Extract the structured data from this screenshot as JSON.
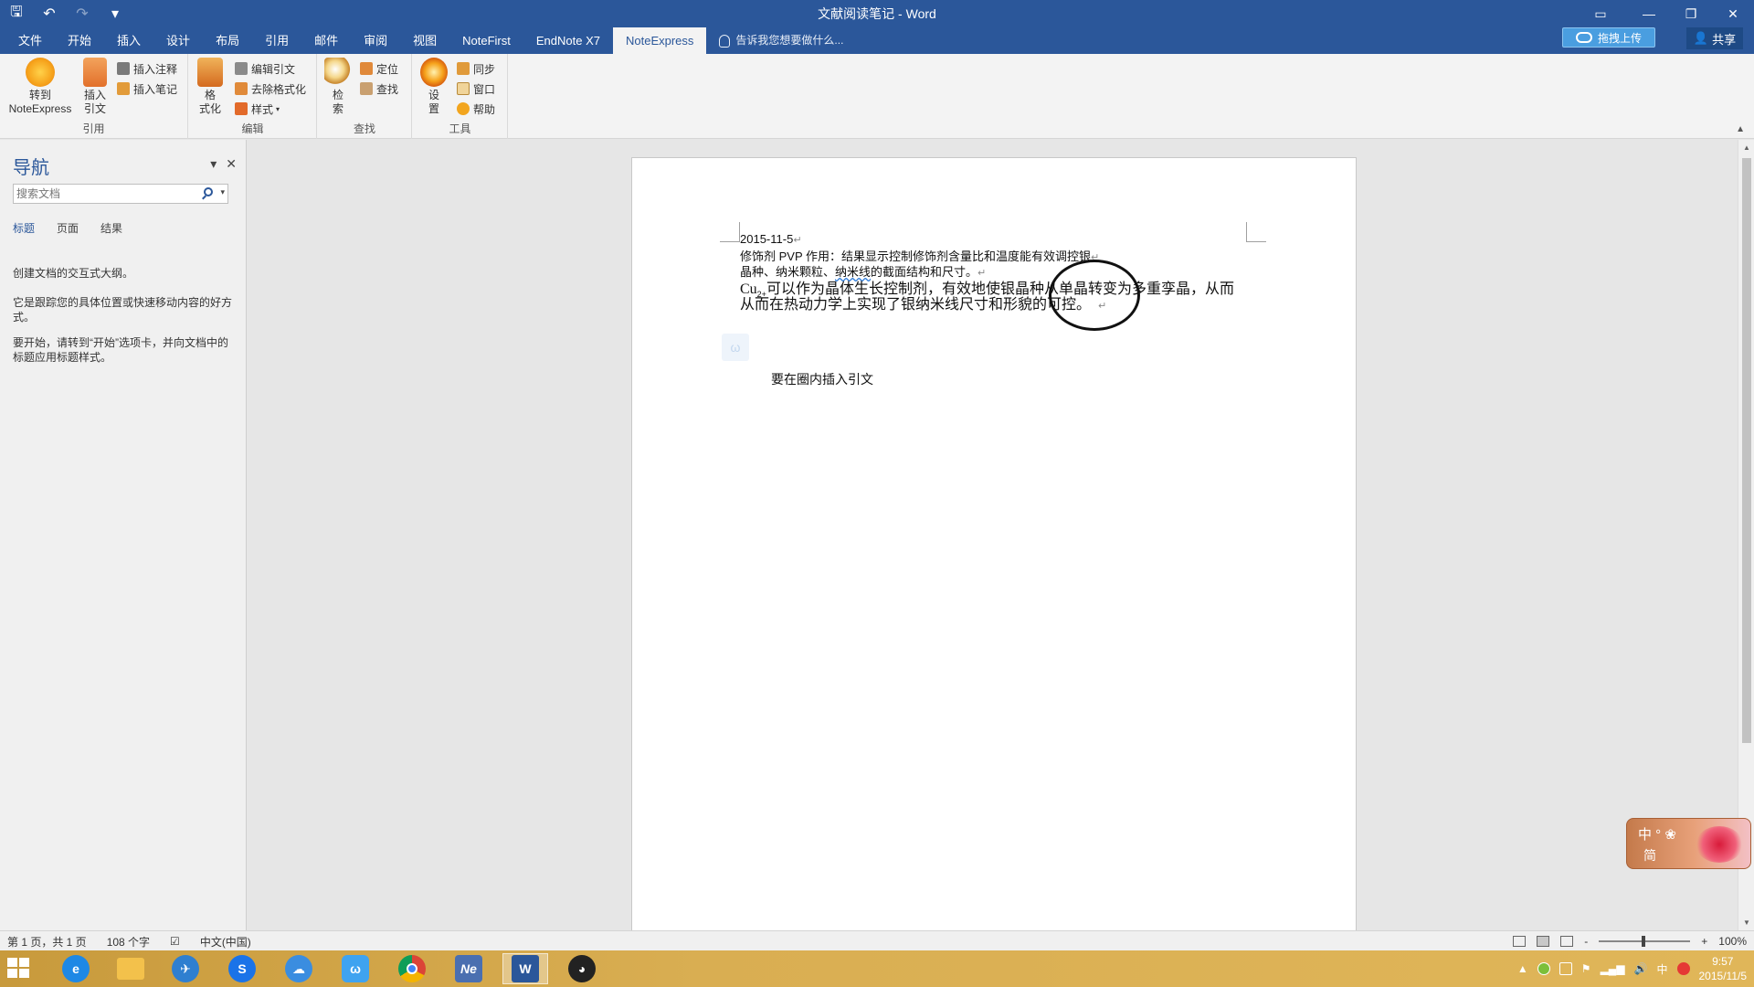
{
  "window": {
    "title": "文献阅读笔记 - Word",
    "ctrl_icons": [
      "ribbon-display-icon",
      "minimize-icon",
      "restore-icon",
      "close-icon"
    ]
  },
  "qat": {
    "save": "🖫",
    "undo": "↶",
    "redo": "↷",
    "customize": "▾"
  },
  "tabs": [
    "文件",
    "开始",
    "插入",
    "设计",
    "布局",
    "引用",
    "邮件",
    "审阅",
    "视图",
    "NoteFirst",
    "EndNote X7",
    "NoteExpress"
  ],
  "active_tab": "NoteExpress",
  "tellme": "告诉我您想要做什么...",
  "upload_label": "拖拽上传",
  "share_label": "共享",
  "ribbon": {
    "groups": {
      "cite": "引用",
      "edit": "编辑",
      "find": "查找",
      "tools": "工具"
    },
    "goto_ne": "转到\nNoteExpress",
    "insert_cite": "插入\n引文",
    "insert_note_comment": "插入注释",
    "insert_note": "插入笔记",
    "format": "格\n式化",
    "edit_cite": "编辑引文",
    "remove_format": "去除格式化",
    "style": "样式",
    "search": "检\n索",
    "locate": "定位",
    "find": "查找",
    "settings": "设\n置",
    "sync": "同步",
    "window": "窗口",
    "help": "帮助"
  },
  "nav": {
    "title": "导航",
    "search_placeholder": "搜索文档",
    "tabs": [
      "标题",
      "页面",
      "结果"
    ],
    "text1": "创建文档的交互式大纲。",
    "text2": "它是跟踪您的具体位置或快速移动内容的好方式。",
    "text3": "要开始，请转到“开始”选项卡，并向文档中的标题应用标题样式。"
  },
  "doc": {
    "line1": "2015-11-5",
    "line2": "修饰剂 PVP 作用：结果显示控制修饰剂含量比和温度能有效调控银",
    "line3a": "晶种、纳米颗粒、",
    "line3b": "纳米线",
    "line3c": "的截面结构和尺寸。",
    "line4a": "Cu",
    "line4b": "2+",
    "line4c": "可以作为晶体生长控制剂，有效地使银晶种从单晶转变为多重孪晶，从而",
    "line5": "从而在热动力学上实现了银纳米线尺寸和形貌的可控。",
    "para_mark": "↵",
    "float_icon": "ω",
    "note": "要在圈内插入引文"
  },
  "ime": {
    "line1": "中 ° ❀",
    "line2": "简"
  },
  "status": {
    "page": "第 1 页，共 1 页",
    "words": "108 个字",
    "lang": "中文(中国)",
    "zoom_minus": "-",
    "zoom_plus": "+",
    "zoom": "100%"
  },
  "taskbar": {
    "apps": [
      "internet-explorer-icon",
      "file-explorer-icon",
      "bird-app-icon",
      "sogou-icon",
      "baidu-cloud-icon",
      "baidu-app-icon",
      "chrome-icon",
      "noteexpress-icon",
      "word-icon",
      "qq-icon"
    ],
    "time": "9:57",
    "date": "2015/11/5",
    "ime": "中"
  },
  "colors": {
    "word_blue": "#2b579a",
    "taskbar_gold": "#d9ae52"
  }
}
